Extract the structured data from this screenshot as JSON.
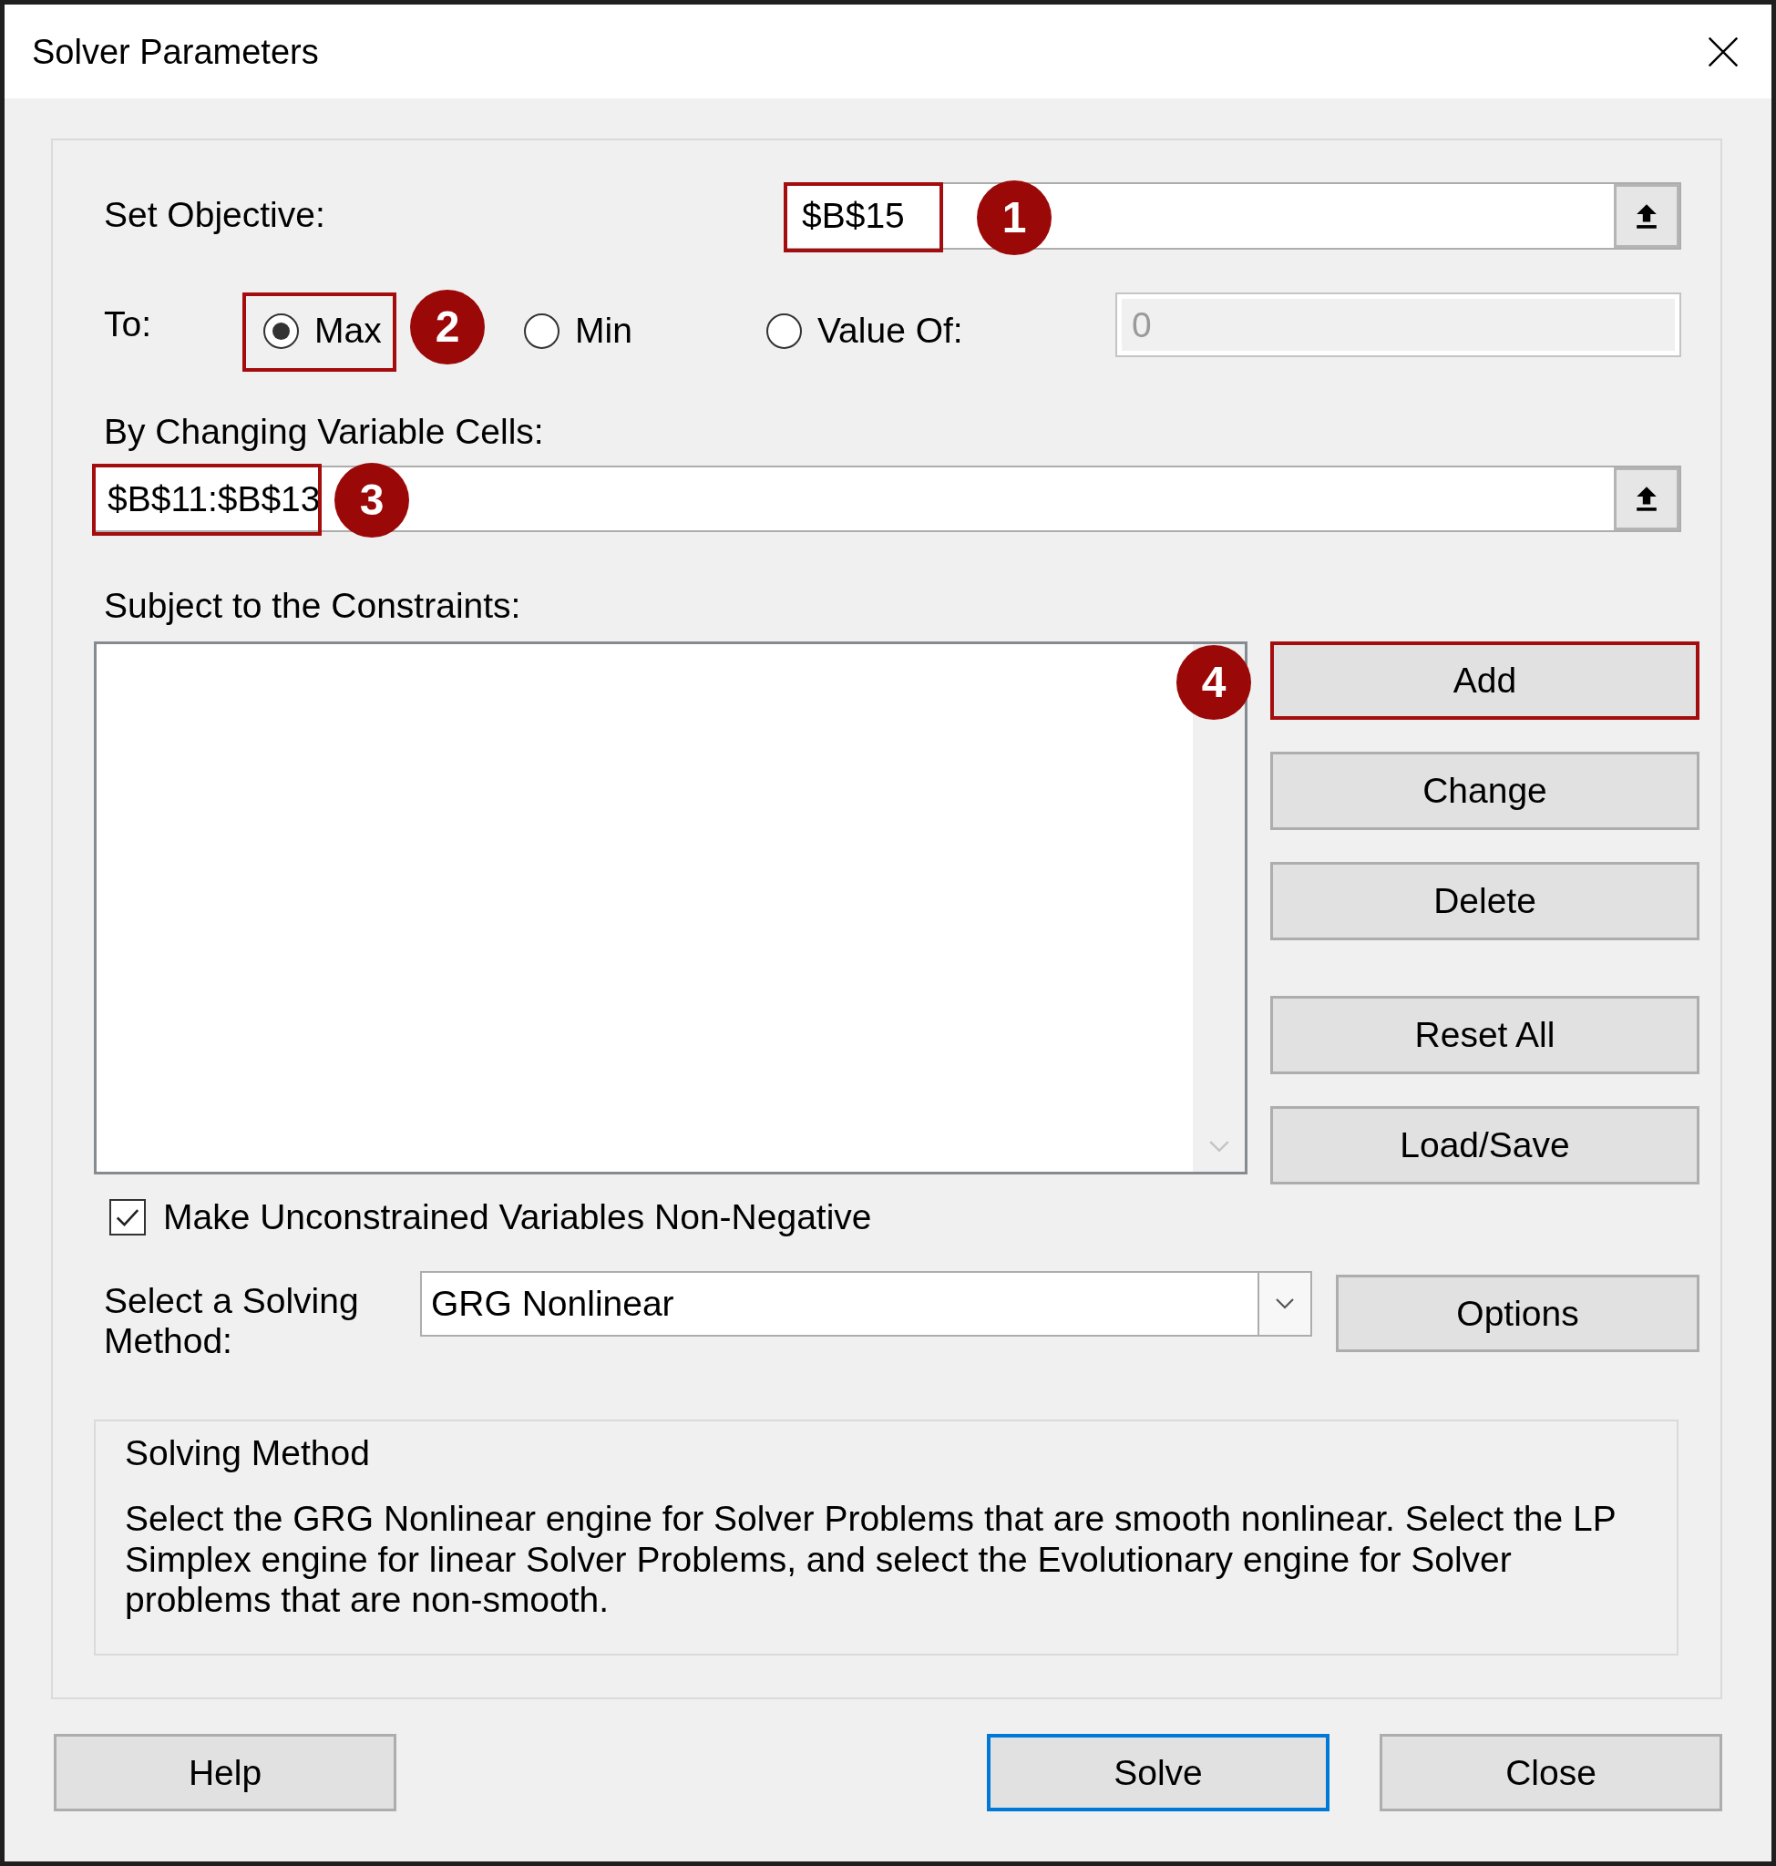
{
  "window": {
    "title": "Solver Parameters"
  },
  "objective": {
    "label": "Set Objective:",
    "value": "$B$15",
    "highlighted": true,
    "callout": "1"
  },
  "target": {
    "label": "To:",
    "options": [
      {
        "label": "Max",
        "selected": true,
        "highlighted": true,
        "callout": "2"
      },
      {
        "label": "Min",
        "selected": false,
        "highlighted": false
      },
      {
        "label": "Value Of:",
        "selected": false,
        "highlighted": false
      }
    ],
    "value_field": {
      "value": "0",
      "disabled": true
    }
  },
  "variables": {
    "label": "By Changing Variable Cells:",
    "value": "$B$11:$B$13",
    "highlighted": true,
    "callout": "3"
  },
  "constraints": {
    "label": "Subject to the Constraints:",
    "buttons": [
      {
        "label": "Add",
        "highlighted": true,
        "callout": "4"
      },
      {
        "label": "Change",
        "highlighted": false
      },
      {
        "label": "Delete",
        "highlighted": false
      },
      {
        "label": "Reset All",
        "highlighted": false
      },
      {
        "label": "Load/Save",
        "highlighted": false
      }
    ]
  },
  "non_negative": {
    "label": "Make Unconstrained Variables Non-Negative",
    "checked": true
  },
  "method": {
    "label": "Select a Solving Method:",
    "value": "GRG Nonlinear",
    "options_button": {
      "label": "Options"
    }
  },
  "method_info": {
    "title": "Solving Method",
    "text": "Select the GRG Nonlinear engine for Solver Problems that are smooth nonlinear. Select the LP Simplex engine for linear Solver Problems, and select the Evolutionary engine for Solver problems that are non-smooth."
  },
  "footer_buttons": [
    {
      "label": "Help",
      "default": false
    },
    {
      "label": "Solve",
      "default": true
    },
    {
      "label": "Close",
      "default": false
    }
  ]
}
